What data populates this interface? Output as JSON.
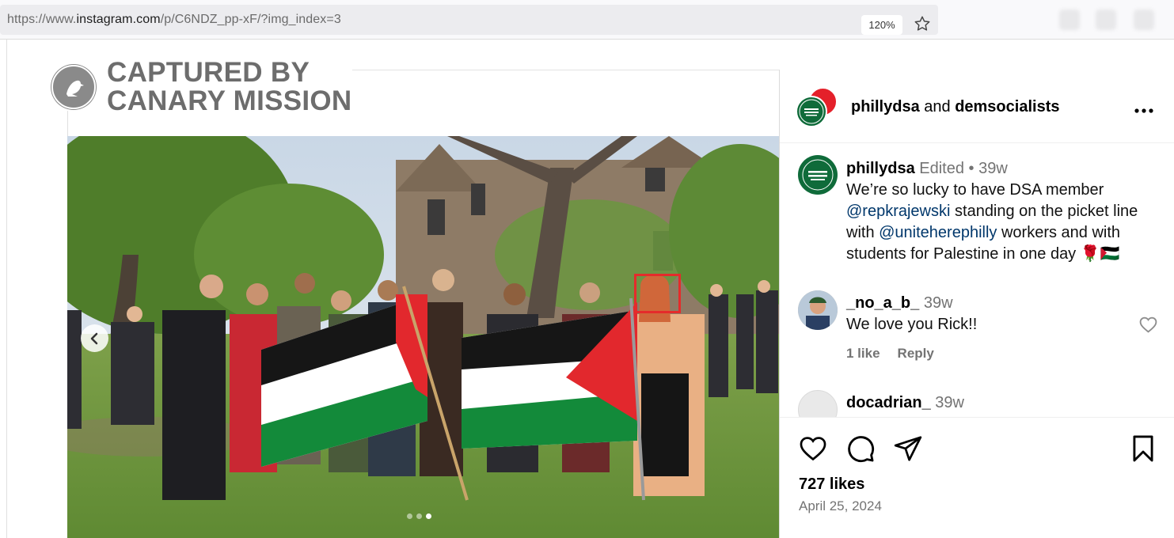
{
  "browser": {
    "url_prefix": "https://www.",
    "url_domain": "instagram.com",
    "url_path": "/p/C6NDZ_pp-xF/?img_index=3",
    "zoom": "120%"
  },
  "watermark": {
    "line1": "CAPTURED BY",
    "line2": "CANARY MISSION"
  },
  "post": {
    "author_primary": "phillydsa",
    "author_joiner": " and ",
    "author_secondary": "demsocialists",
    "avatar_text": "Philadelphia DEMOCRATIC SOCIALISTS of America",
    "caption": {
      "user": "phillydsa",
      "edited": "Edited",
      "bullet": "•",
      "age": "39w",
      "text_1": "We’re so lucky to have DSA member",
      "mention_1": "@repkrajewski",
      "text_2": " standing on the picket line",
      "text_3": "with ",
      "mention_2": "@uniteherephilly",
      "text_4": " workers and with",
      "text_5": "students for Palestine in one day 🌹🇵🇸"
    },
    "comments": [
      {
        "user": "_no_a_b_",
        "age": "39w",
        "text": "We love you Rick!!",
        "likes": "1 like",
        "reply": "Reply"
      },
      {
        "user": "docadrian_",
        "age": "39w"
      }
    ],
    "likes": "727 likes",
    "date": "April 25, 2024",
    "carousel": {
      "count": 3,
      "active": 3
    }
  },
  "colors": {
    "instagram_link": "#00376b",
    "highlight": "#e52b2b",
    "dsa_green": "#0f6b3a",
    "dsa_red": "#e4202a"
  },
  "icons": [
    "star-icon",
    "canary-logo-icon",
    "chevron-left-icon",
    "more-icon",
    "heart-icon",
    "comment-icon",
    "share-icon",
    "save-icon"
  ]
}
